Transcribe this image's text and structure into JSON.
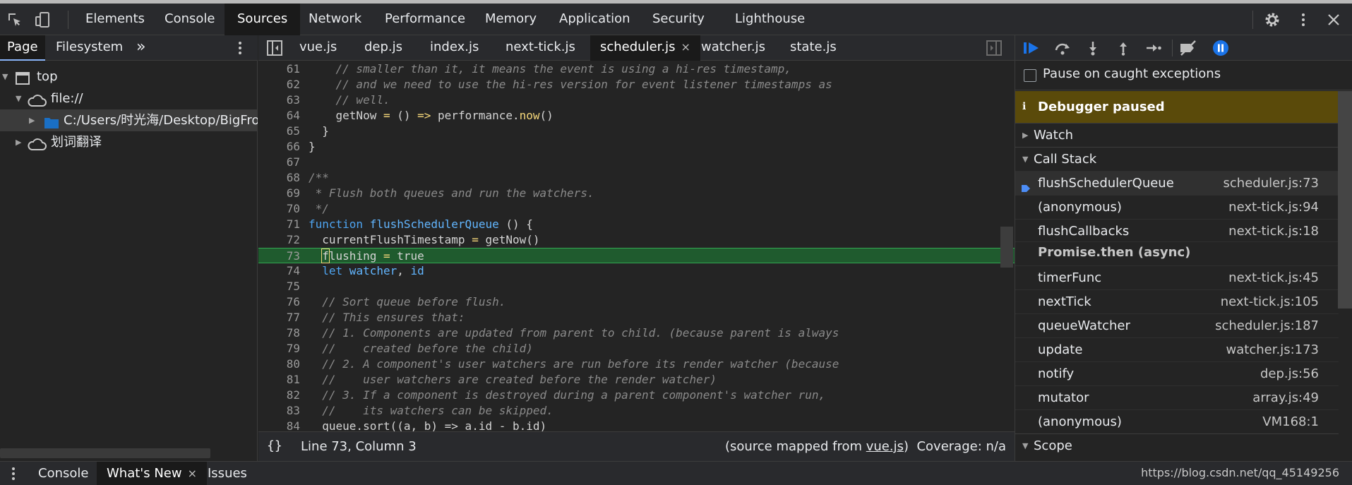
{
  "toolbar": {
    "tabs": [
      "Elements",
      "Console",
      "Sources",
      "Network",
      "Performance",
      "Memory",
      "Application",
      "Security",
      "Lighthouse"
    ],
    "active_tab": "Sources"
  },
  "navigator": {
    "tabs": [
      "Page",
      "Filesystem"
    ],
    "more": "»",
    "tree": [
      "top",
      "file://",
      "C:/Users/时光海/Desktop/BigFront",
      "划词翻译"
    ]
  },
  "editor": {
    "file_tabs": [
      "vue.js",
      "dep.js",
      "index.js",
      "next-tick.js",
      "scheduler.js",
      "watcher.js",
      "state.js"
    ],
    "active_file": "scheduler.js",
    "close_glyph": "×",
    "line_numbers": [
      "61",
      "62",
      "63",
      "64",
      "65",
      "66",
      "67",
      "68",
      "69",
      "70",
      "71",
      "72",
      "73",
      "74",
      "75",
      "76",
      "77",
      "78",
      "79",
      "80",
      "81",
      "82",
      "83",
      "84"
    ],
    "lines": {
      "l61": "    // smaller than it, it means the event is using a hi-res timestamp,",
      "l62": "    // and we need to use the hi-res version for event listener timestamps as",
      "l63": "    // well.",
      "l64a": "    getNow ",
      "l64b": "=",
      "l64c": " () ",
      "l64d": "=>",
      "l64e": " performance.",
      "l64f": "now",
      "l64g": "()",
      "l65": "  }",
      "l66": "}",
      "l67": "",
      "l68": "/**",
      "l69": " * Flush both queues and run the watchers.",
      "l70": " */",
      "l71a": "function",
      "l71b": " flushSchedulerQueue",
      "l71c": " () {",
      "l72a": "  currentFlushTimestamp ",
      "l72b": "=",
      "l72c": " getNow()",
      "l73a": "  ",
      "l73b": "f",
      "l73c": "lushing ",
      "l73d": "=",
      "l73e": " true",
      "l74a": "  let",
      "l74b": " watcher",
      "l74c": ", ",
      "l74d": "id",
      "l75": "",
      "l76": "  // Sort queue before flush.",
      "l77": "  // This ensures that:",
      "l78": "  // 1. Components are updated from parent to child. (because parent is always",
      "l79": "  //    created before the child)",
      "l80": "  // 2. A component's user watchers are run before its render watcher (because",
      "l81": "  //    user watchers are created before the render watcher)",
      "l82": "  // 3. If a component is destroyed during a parent component's watcher run,",
      "l83": "  //    its watchers can be skipped.",
      "l84": "  queue.sort((a, b) => a.id - b.id)"
    },
    "status": {
      "braces": "{}",
      "position": "Line 73, Column 3",
      "mapped_prefix": "(source mapped from ",
      "mapped_link": "vue.js",
      "mapped_suffix": ")",
      "coverage": "Coverage: n/a"
    }
  },
  "debugger": {
    "pause_on_caught": "Pause on caught exceptions",
    "paused_icon": "ℹ",
    "paused_title": "Debugger paused",
    "watch_label": "Watch",
    "call_stack_label": "Call Stack",
    "scope_label": "Scope",
    "frames": [
      {
        "name": "flushSchedulerQueue",
        "loc": "scheduler.js:73"
      },
      {
        "name": "(anonymous)",
        "loc": "next-tick.js:94"
      },
      {
        "name": "flushCallbacks",
        "loc": "next-tick.js:18"
      },
      {
        "name": "Promise.then (async)",
        "loc": ""
      },
      {
        "name": "timerFunc",
        "loc": "next-tick.js:45"
      },
      {
        "name": "nextTick",
        "loc": "next-tick.js:105"
      },
      {
        "name": "queueWatcher",
        "loc": "scheduler.js:187"
      },
      {
        "name": "update",
        "loc": "watcher.js:173"
      },
      {
        "name": "notify",
        "loc": "dep.js:56"
      },
      {
        "name": "mutator",
        "loc": "array.js:49"
      },
      {
        "name": "(anonymous)",
        "loc": "VM168:1"
      }
    ]
  },
  "drawer": {
    "tabs": [
      "Console",
      "What's New",
      "Issues"
    ],
    "active_tab": "What's New",
    "close_glyph": "×",
    "watermark": "https://blog.csdn.net/qq_45149256"
  },
  "colors": {
    "exec_line": "#1f5b2e",
    "paused_banner": "#5a4a0a",
    "accent_blue": "#1a73e8"
  }
}
